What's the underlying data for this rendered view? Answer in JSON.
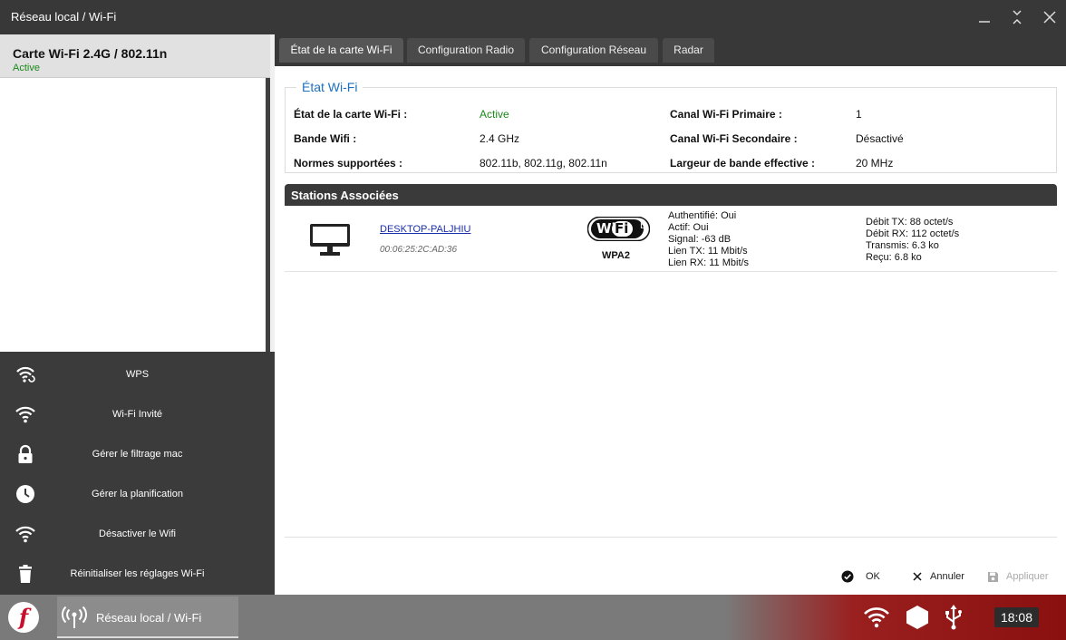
{
  "window": {
    "title": "Réseau local / Wi-Fi"
  },
  "sidebar": {
    "card": {
      "name": "Carte Wi-Fi 2.4G / 802.11n",
      "status": "Active"
    },
    "actions": [
      {
        "label": "WPS",
        "icon": "wifi-wps-icon"
      },
      {
        "label": "Wi-Fi Invité",
        "icon": "wifi-icon"
      },
      {
        "label": "Gérer le filtrage mac",
        "icon": "lock-icon"
      },
      {
        "label": "Gérer la planification",
        "icon": "clock-icon"
      },
      {
        "label": "Désactiver le Wifi",
        "icon": "wifi-icon"
      },
      {
        "label": "Réinitialiser les réglages Wi-Fi",
        "icon": "trash-icon"
      }
    ]
  },
  "tabs": [
    {
      "label": "État de la carte Wi-Fi",
      "active": true
    },
    {
      "label": "Configuration Radio",
      "active": false
    },
    {
      "label": "Configuration Réseau",
      "active": false
    },
    {
      "label": "Radar",
      "active": false
    }
  ],
  "wifi_state": {
    "legend": "État Wi-Fi",
    "rows": [
      {
        "k1": "État de la carte Wi-Fi :",
        "v1": "Active",
        "k2": "Canal Wi-Fi Primaire :",
        "v2": "1"
      },
      {
        "k1": "Bande Wifi :",
        "v1": "2.4 GHz",
        "k2": "Canal Wi-Fi Secondaire :",
        "v2": "Désactivé"
      },
      {
        "k1": "Normes supportées :",
        "v1": "802.11b, 802.11g, 802.11n",
        "k2": "Largeur de bande effective :",
        "v2": "20 MHz"
      }
    ]
  },
  "stations": {
    "header": "Stations Associées",
    "items": [
      {
        "name": "DESKTOP-PALJHIU",
        "mac": "00:06:25:2C:AD:36",
        "wifi_logo": "WiFi",
        "wifi_std": "b",
        "security": "WPA2",
        "info_left": [
          "Authentifié: Oui",
          "Actif: Oui",
          "Signal: -63 dB",
          "Lien TX: 11 Mbit/s",
          "Lien RX: 11 Mbit/s"
        ],
        "info_right": [
          "Débit TX: 88 octet/s",
          "Débit RX: 112 octet/s",
          "Transmis: 6.3 ko",
          "Reçu: 6.8 ko"
        ]
      }
    ]
  },
  "dialog_buttons": {
    "ok": "OK",
    "cancel": "Annuler",
    "apply": "Appliquer"
  },
  "taskbar": {
    "logo": "f",
    "task_label": "Réseau local / Wi-Fi",
    "clock": "18:08"
  },
  "colors": {
    "accent_blue": "#1e6fbf",
    "active_green": "#1a8a1a",
    "brand_red": "#c8102e"
  }
}
